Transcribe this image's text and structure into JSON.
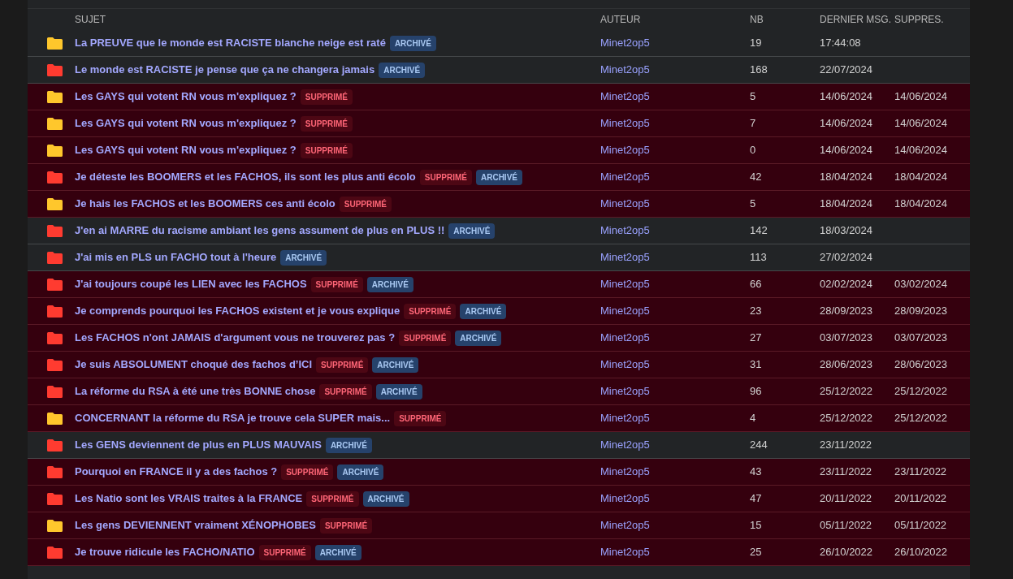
{
  "table": {
    "columns": [
      "SUJET",
      "AUTEUR",
      "NB",
      "DERNIER MSG.",
      "SUPPRES."
    ],
    "rows": [
      {
        "color": "#ffc72c",
        "deleted": false,
        "subject": "La PREUVE que le monde est RACISTE blanche neige est raté",
        "badges": [
          {
            "kind": "archived",
            "label": "ARCHIVÉ"
          }
        ],
        "author": "Minet2op5",
        "count": "19",
        "last": "17:44:08"
      },
      {
        "color": "#ff3b30",
        "deleted": false,
        "subject": "Le monde est RACISTE je pense que ça ne changera jamais",
        "badges": [
          {
            "kind": "archived",
            "label": "ARCHIVÉ"
          }
        ],
        "author": "Minet2op5",
        "count": "168",
        "last": "22/07/2024"
      },
      {
        "color": "#ffc72c",
        "deleted": true,
        "subject": "Les GAYS qui votent RN vous m'expliquez ?",
        "badges": [
          {
            "kind": "deleted",
            "label": "SUPPRIMÉ"
          }
        ],
        "author": "Minet2op5",
        "count": "5",
        "last": "14/06/2024",
        "removed": "14/06/2024"
      },
      {
        "color": "#ffc72c",
        "deleted": true,
        "subject": "Les GAYS qui votent RN vous m'expliquez ?",
        "badges": [
          {
            "kind": "deleted",
            "label": "SUPPRIMÉ"
          }
        ],
        "author": "Minet2op5",
        "count": "7",
        "last": "14/06/2024",
        "removed": "14/06/2024"
      },
      {
        "color": "#ffc72c",
        "deleted": true,
        "subject": "Les GAYS qui votent RN vous m'expliquez ?",
        "badges": [
          {
            "kind": "deleted",
            "label": "SUPPRIMÉ"
          }
        ],
        "author": "Minet2op5",
        "count": "0",
        "last": "14/06/2024",
        "removed": "14/06/2024"
      },
      {
        "color": "#ff3b30",
        "deleted": true,
        "subject": "Je déteste les BOOMERS et les FACHOS, ils sont les plus anti écolo",
        "badges": [
          {
            "kind": "deleted",
            "label": "SUPPRIMÉ"
          },
          {
            "kind": "archived",
            "label": "ARCHIVÉ"
          }
        ],
        "author": "Minet2op5",
        "count": "42",
        "last": "18/04/2024",
        "removed": "18/04/2024"
      },
      {
        "color": "#ffc72c",
        "deleted": true,
        "subject": "Je hais les FACHOS et les BOOMERS ces anti écolo",
        "badges": [
          {
            "kind": "deleted",
            "label": "SUPPRIMÉ"
          }
        ],
        "author": "Minet2op5",
        "count": "5",
        "last": "18/04/2024",
        "removed": "18/04/2024"
      },
      {
        "color": "#ff3b30",
        "deleted": false,
        "subject": "J'en ai MARRE du racisme ambiant les gens assument de plus en PLUS !!",
        "badges": [
          {
            "kind": "archived",
            "label": "ARCHIVÉ"
          }
        ],
        "author": "Minet2op5",
        "count": "142",
        "last": "18/03/2024"
      },
      {
        "color": "#ff3b30",
        "deleted": false,
        "subject": "J'ai mis en PLS un FACHO tout à l'heure",
        "badges": [
          {
            "kind": "archived",
            "label": "ARCHIVÉ"
          }
        ],
        "author": "Minet2op5",
        "count": "113",
        "last": "27/02/2024"
      },
      {
        "color": "#ff3b30",
        "deleted": true,
        "subject": "J'ai toujours coupé les LIEN avec les FACHOS",
        "badges": [
          {
            "kind": "deleted",
            "label": "SUPPRIMÉ"
          },
          {
            "kind": "archived",
            "label": "ARCHIVÉ"
          }
        ],
        "author": "Minet2op5",
        "count": "66",
        "last": "02/02/2024",
        "removed": "03/02/2024"
      },
      {
        "color": "#ff3b30",
        "deleted": true,
        "subject": "Je comprends pourquoi les FACHOS existent et je vous explique",
        "badges": [
          {
            "kind": "deleted",
            "label": "SUPPRIMÉ"
          },
          {
            "kind": "archived",
            "label": "ARCHIVÉ"
          }
        ],
        "author": "Minet2op5",
        "count": "23",
        "last": "28/09/2023",
        "removed": "28/09/2023"
      },
      {
        "color": "#ff3b30",
        "deleted": true,
        "subject": "Les FACHOS n'ont JAMAIS d'argument vous ne trouverez pas ?",
        "badges": [
          {
            "kind": "deleted",
            "label": "SUPPRIMÉ"
          },
          {
            "kind": "archived",
            "label": "ARCHIVÉ"
          }
        ],
        "author": "Minet2op5",
        "count": "27",
        "last": "03/07/2023",
        "removed": "03/07/2023"
      },
      {
        "color": "#ff3b30",
        "deleted": true,
        "subject": "Je suis ABSOLUMENT choqué des fachos d’ICI",
        "badges": [
          {
            "kind": "deleted",
            "label": "SUPPRIMÉ"
          },
          {
            "kind": "archived",
            "label": "ARCHIVÉ"
          }
        ],
        "author": "Minet2op5",
        "count": "31",
        "last": "28/06/2023",
        "removed": "28/06/2023"
      },
      {
        "color": "#ff3b30",
        "deleted": true,
        "subject": "La réforme du RSA à été une très BONNE chose",
        "badges": [
          {
            "kind": "deleted",
            "label": "SUPPRIMÉ"
          },
          {
            "kind": "archived",
            "label": "ARCHIVÉ"
          }
        ],
        "author": "Minet2op5",
        "count": "96",
        "last": "25/12/2022",
        "removed": "25/12/2022"
      },
      {
        "color": "#ffc72c",
        "deleted": true,
        "subject": "CONCERNANT la réforme du RSA je trouve cela SUPER mais...",
        "badges": [
          {
            "kind": "deleted",
            "label": "SUPPRIMÉ"
          }
        ],
        "author": "Minet2op5",
        "count": "4",
        "last": "25/12/2022",
        "removed": "25/12/2022"
      },
      {
        "color": "#ff3b30",
        "deleted": false,
        "subject": "Les GENS deviennent de plus en PLUS MAUVAIS",
        "badges": [
          {
            "kind": "archived",
            "label": "ARCHIVÉ"
          }
        ],
        "author": "Minet2op5",
        "count": "244",
        "last": "23/11/2022"
      },
      {
        "color": "#ff3b30",
        "deleted": true,
        "subject": "Pourquoi en FRANCE il y a des fachos ?",
        "badges": [
          {
            "kind": "deleted",
            "label": "SUPPRIMÉ"
          },
          {
            "kind": "archived",
            "label": "ARCHIVÉ"
          }
        ],
        "author": "Minet2op5",
        "count": "43",
        "last": "23/11/2022",
        "removed": "23/11/2022"
      },
      {
        "color": "#ff3b30",
        "deleted": true,
        "subject": "Les Natio sont les VRAIS traites à la FRANCE",
        "badges": [
          {
            "kind": "deleted",
            "label": "SUPPRIMÉ"
          },
          {
            "kind": "archived",
            "label": "ARCHIVÉ"
          }
        ],
        "author": "Minet2op5",
        "count": "47",
        "last": "20/11/2022",
        "removed": "20/11/2022"
      },
      {
        "color": "#ffc72c",
        "deleted": true,
        "subject": "Les gens DEVIENNENT vraiment XÉNOPHOBES",
        "badges": [
          {
            "kind": "deleted",
            "label": "SUPPRIMÉ"
          }
        ],
        "author": "Minet2op5",
        "count": "15",
        "last": "05/11/2022",
        "removed": "05/11/2022"
      },
      {
        "color": "#ff3b30",
        "deleted": true,
        "subject": "Je trouve ridicule les FACHO/NATIO",
        "badges": [
          {
            "kind": "deleted",
            "label": "SUPPRIMÉ"
          },
          {
            "kind": "archived",
            "label": "ARCHIVÉ"
          }
        ],
        "author": "Minet2op5",
        "count": "25",
        "last": "26/10/2022",
        "removed": "26/10/2022"
      }
    ]
  }
}
